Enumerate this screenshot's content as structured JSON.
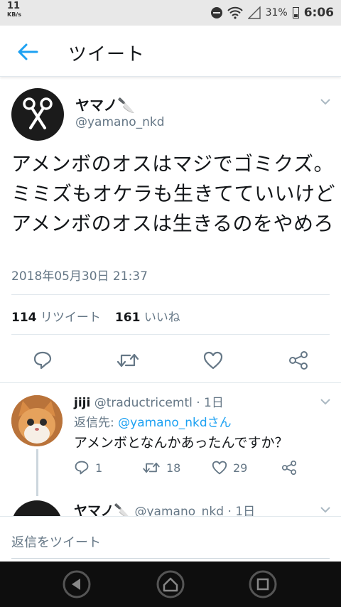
{
  "status_bar": {
    "speed_value": "11",
    "speed_unit": "KB/s",
    "battery": "31%",
    "time": "6:06"
  },
  "header": {
    "title": "ツイート"
  },
  "tweet": {
    "name": "ヤマノ🔪",
    "handle": "@yamano_nkd",
    "text": "アメンボのオスはマジでゴミクズ。ミミズもオケラも生きてていいけどアメンボのオスは生きるのをやめろ",
    "timestamp": "2018年05月30日 21:37",
    "retweet_count": "114",
    "retweet_label": "リツイート",
    "like_count": "161",
    "like_label": "いいね"
  },
  "reply": {
    "name": "jiji",
    "handle_meta": "@traductricemtl · 1日",
    "reply_to_label": "返信先: ",
    "reply_to_mention": "@yamano_nkdさん",
    "text": "アメンボとなんかあったんですか？",
    "reply_count": "1",
    "retweet_count": "18",
    "like_count": "29"
  },
  "next_reply": {
    "name": "ヤマノ🔪",
    "handle_meta": "@yamano_nkd · 1日"
  },
  "composer": {
    "placeholder": "返信をツイート"
  },
  "colors": {
    "accent": "#1da1f2",
    "secondary_text": "#657786",
    "divider": "#e1e8ed"
  }
}
